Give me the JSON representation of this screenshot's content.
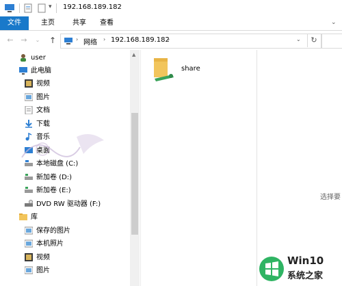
{
  "window": {
    "title": "192.168.189.182"
  },
  "ribbon": {
    "tabs": [
      "文件",
      "主页",
      "共享",
      "查看"
    ]
  },
  "address": {
    "crumbs": [
      "网络",
      "192.168.189.182"
    ]
  },
  "nav": {
    "user": "user",
    "this_pc": "此电脑",
    "pc_items": [
      "视频",
      "图片",
      "文档",
      "下载",
      "音乐",
      "桌面",
      "本地磁盘 (C:)",
      "新加卷 (D:)",
      "新加卷 (E:)",
      "DVD RW 驱动器 (F:)"
    ],
    "library": "库",
    "library_items": [
      "保存的图片",
      "本机照片",
      "视频",
      "图片"
    ]
  },
  "content": {
    "items": [
      {
        "label": "share",
        "icon": "shared-folder-icon"
      }
    ]
  },
  "preview": {
    "text": "选择要"
  },
  "watermark": {
    "line1": "Win10",
    "line2": "系统之家"
  },
  "colors": {
    "accent": "#1979ca",
    "folder": "#f2c55c",
    "win_logo": "#2fb463"
  }
}
